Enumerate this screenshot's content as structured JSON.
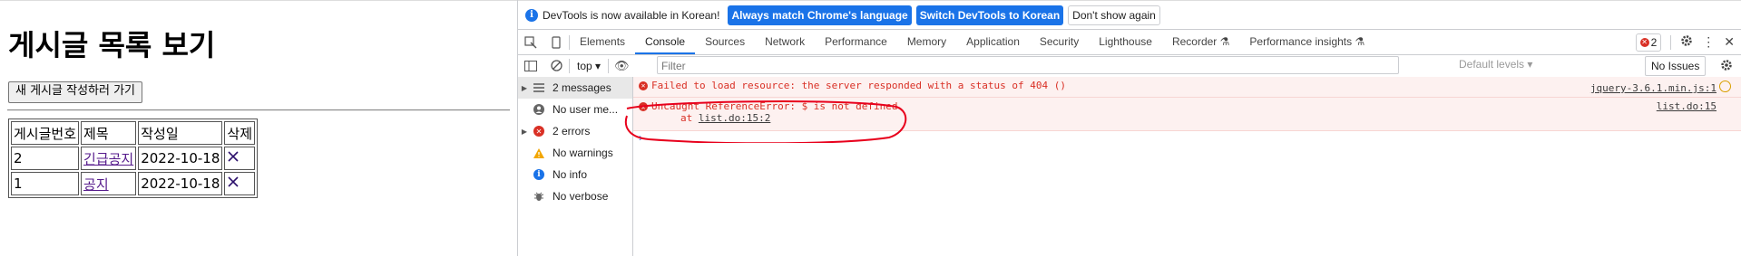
{
  "page": {
    "title": "게시글 목록 보기",
    "new_post_button": "새 게시글 작성하러 가기",
    "table": {
      "headers": [
        "게시글번호",
        "제목",
        "작성일",
        "삭제"
      ],
      "rows": [
        {
          "no": "2",
          "title": "긴급공지",
          "date": "2022-10-18",
          "delete": "X"
        },
        {
          "no": "1",
          "title": "공지",
          "date": "2022-10-18",
          "delete": "X"
        }
      ]
    }
  },
  "devtools": {
    "infobar": {
      "text": "DevTools is now available in Korean!",
      "btn_match": "Always match Chrome's language",
      "btn_switch": "Switch DevTools to Korean",
      "btn_dismiss": "Don't show again"
    },
    "tabs": [
      "Elements",
      "Console",
      "Sources",
      "Network",
      "Performance",
      "Memory",
      "Application",
      "Security",
      "Lighthouse",
      "Recorder",
      "Performance insights"
    ],
    "active_tab": "Console",
    "error_count": "2",
    "context": "top",
    "filter_placeholder": "Filter",
    "levels": "Default levels",
    "issues": "No Issues",
    "sidebar": [
      "2 messages",
      "No user me...",
      "2 errors",
      "No warnings",
      "No info",
      "No verbose"
    ],
    "messages": [
      {
        "text": "Failed to load resource: the server responded with a status of 404 ()",
        "source": "jquery-3.6.1.min.js:1"
      },
      {
        "text": "Uncaught ReferenceError: $ is not defined",
        "at_prefix": "at",
        "at_link": "list.do:15:2",
        "source": "list.do:15"
      }
    ],
    "colors": {
      "accent": "#1a73e8",
      "error": "#d93025",
      "annotation": "#e8001c"
    }
  }
}
